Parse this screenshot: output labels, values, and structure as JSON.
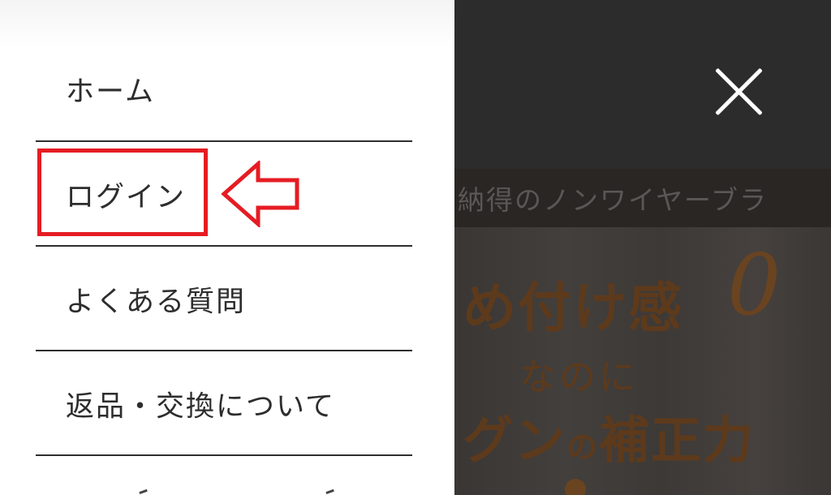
{
  "menu": {
    "items": [
      {
        "label": "ホーム"
      },
      {
        "label": "ログイン"
      },
      {
        "label": "よくある質問"
      },
      {
        "label": "返品・交換について"
      }
    ]
  },
  "annotation": {
    "highlight_color": "#e51c23",
    "arrow_icon": "left-arrow-outline-icon"
  },
  "background_page": {
    "banner_text": "納得のノンワイヤーブラ",
    "hero": {
      "line1": "め付け感",
      "zero": "0",
      "line2": "なのに",
      "line3_prefix": "グン",
      "line3_particle": "の",
      "line3_suffix": "補正力"
    }
  },
  "close_icon": "close-icon"
}
